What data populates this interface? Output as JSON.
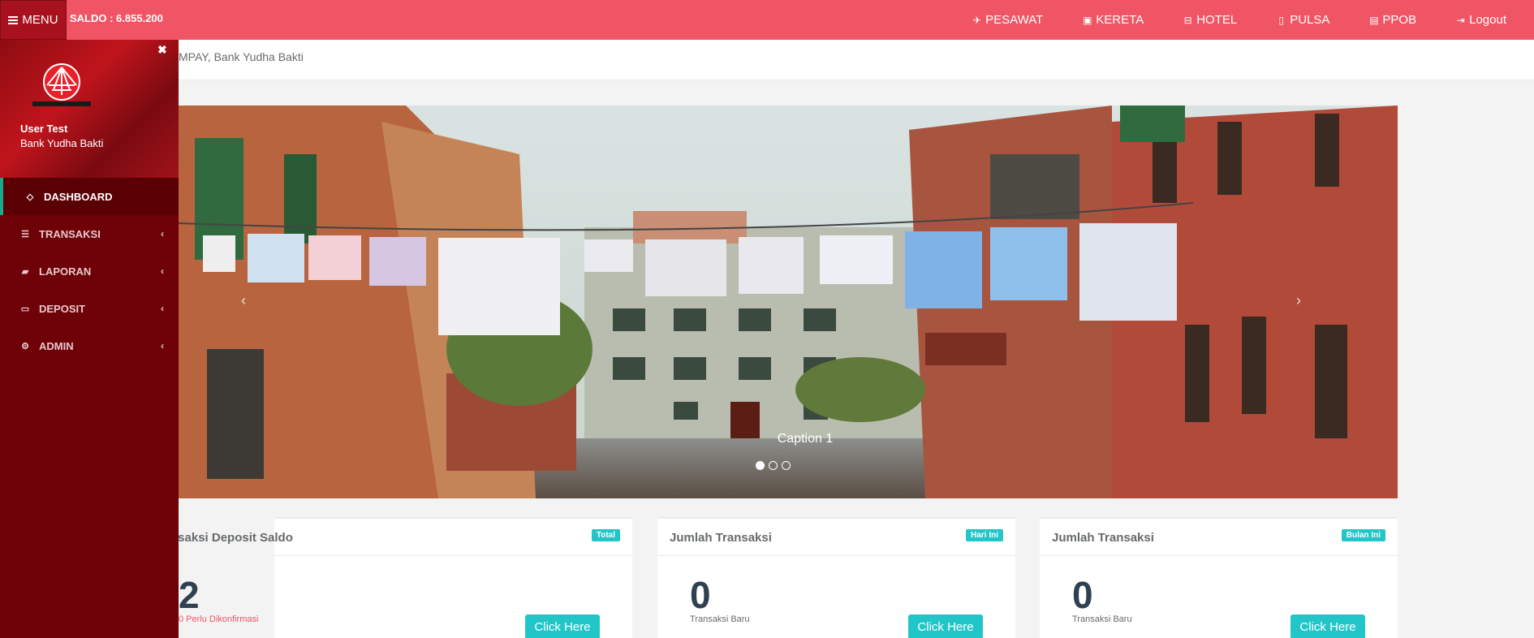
{
  "topbar": {
    "menu_label": "MENU",
    "saldo": "SALDO : 6.855.200",
    "nav": [
      {
        "label": "PESAWAT",
        "icon": "plane-icon",
        "glyph": "✈"
      },
      {
        "label": "KERETA",
        "icon": "train-icon",
        "glyph": "▣"
      },
      {
        "label": "HOTEL",
        "icon": "bed-icon",
        "glyph": "⊟"
      },
      {
        "label": "PULSA",
        "icon": "mobile-icon",
        "glyph": "▯"
      },
      {
        "label": "PPOB",
        "icon": "document-icon",
        "glyph": "▤"
      },
      {
        "label": "Logout",
        "icon": "sign-out-icon",
        "glyph": "⇥"
      }
    ]
  },
  "header": {
    "text": "MPAY, Bank Yudha Bakti"
  },
  "sidebar": {
    "close_glyph": "✖",
    "profile": {
      "name": "User Test",
      "bank": "Bank Yudha Bakti"
    },
    "items": [
      {
        "label": "DASHBOARD",
        "icon": "diamond-icon",
        "glyph": "◇",
        "chevron": ""
      },
      {
        "label": "TRANSAKSI",
        "icon": "list-icon",
        "glyph": "☰",
        "chevron": "‹"
      },
      {
        "label": "LAPORAN",
        "icon": "book-icon",
        "glyph": "▰",
        "chevron": "‹"
      },
      {
        "label": "DEPOSIT",
        "icon": "credit-card-icon",
        "glyph": "▭",
        "chevron": "‹"
      },
      {
        "label": "ADMIN",
        "icon": "gear-icon",
        "glyph": "⚙",
        "chevron": "‹"
      }
    ]
  },
  "carousel": {
    "caption": "Caption 1",
    "prev_glyph": "‹",
    "next_glyph": "›"
  },
  "cards": [
    {
      "title": "nsaksi Deposit Saldo",
      "badge": "Total",
      "value": "2",
      "sub": "0 Perlu Dikonfirmasi",
      "button": "Click Here"
    },
    {
      "title": "Jumlah Transaksi",
      "badge": "Hari Ini",
      "value": "0",
      "sub": "Transaksi Baru",
      "button": "Click Here"
    },
    {
      "title": "Jumlah Transaksi",
      "badge": "Bulan Ini",
      "value": "0",
      "sub": "Transaksi Baru",
      "button": "Click Here"
    }
  ],
  "colors": {
    "topbar": "#f05565",
    "sidebar": "#6e0007",
    "accent": "#23c6c8"
  }
}
